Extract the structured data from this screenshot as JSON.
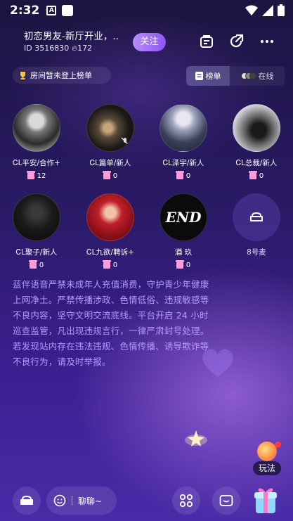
{
  "status_bar": {
    "time": "2:32",
    "a_icon": "A"
  },
  "header": {
    "room_title": "初恋男友-新厅开业，..",
    "room_id": "ID 3516830",
    "heat": "172",
    "follow_label": "关注"
  },
  "rank": {
    "no_rank_text": "房间暂未登上榜单",
    "tab_rank": "榜单",
    "tab_online": "在线"
  },
  "seats": [
    {
      "name": "ᏟL平安/合作+",
      "gifts": "12"
    },
    {
      "name": "ᏟL篇单/新人",
      "gifts": "0"
    },
    {
      "name": "ᏟL泽宇/新人",
      "gifts": "0"
    },
    {
      "name": "ᏟL总裁/新人",
      "gifts": "0"
    },
    {
      "name": "ᏟL聚子/新人",
      "gifts": "0"
    },
    {
      "name": "ᏟL九欲/聘诉+",
      "gifts": "0"
    },
    {
      "name": "酒 玖",
      "gifts": "0",
      "avatar_text": "END"
    },
    {
      "name": "8号麦"
    }
  ],
  "notice": "蓝伴语音严禁未成年人充值消费，守护青少年健康上网净土。严禁传播涉政、色情低俗、违规敏感等不良内容，坚守文明交流底线。平台开启 24 小时巡查监管，凡出现违规言行，一律严肃封号处理。若发现站内存在违法违规、色情传播、诱导欺诈等不良行为，请及时举报。",
  "bottom": {
    "chat_placeholder": "聊聊~",
    "play_label": "玩法"
  },
  "colors": {
    "accent": "#9d6bff",
    "notice_text": "#b29bff",
    "gift_pink": "#ff9bd8"
  }
}
